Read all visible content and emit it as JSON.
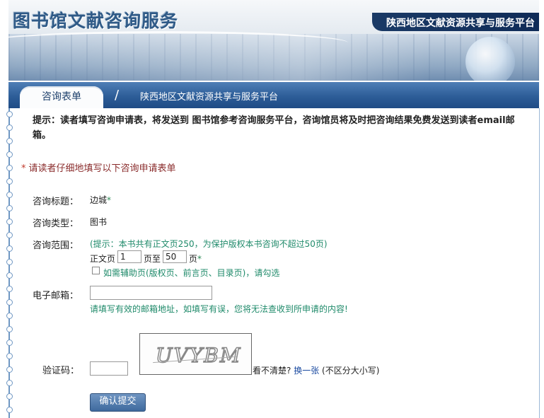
{
  "header": {
    "logo_text": "图书馆文献咨询服务",
    "platform_title": "陕西地区文献资源共享与服务平台"
  },
  "nav": {
    "active_tab": "咨询表单",
    "separator": "/",
    "breadcrumb": "陕西地区文献资源共享与服务平台"
  },
  "tip": "提示：读者填写咨询申请表，将发送到 图书馆参考咨询服务平台，咨询馆员将及时把咨询结果免费发送到读者email邮箱。",
  "notice": {
    "star": "*",
    "text": "请读者仔细地填写以下咨询申请表单"
  },
  "form": {
    "title_label": "咨询标题：",
    "title_value": "边城",
    "required_mark": "*",
    "type_label": "咨询类型：",
    "type_value": "图书",
    "range_label": "咨询范围：",
    "range_hint": "(提示：本书共有正文页250，为保护版权本书咨询不超过50页)",
    "page_prefix": "正文页",
    "page_from": "1",
    "page_mid": "页至",
    "page_to": "50",
    "page_suffix": "页",
    "aux_pages_label": "如需辅助页(版权页、前言页、目录页)，请勾选",
    "email_label": "电子邮箱：",
    "email_value": "",
    "email_hint": "请填写有效的邮箱地址，如填写有误，您将无法查收到所申请的内容!",
    "captcha_label": "验证码：",
    "captcha_value": "",
    "captcha_image_text": "UVYBM",
    "captcha_unclear": "看不清楚?",
    "captcha_refresh": "换一张",
    "captcha_case_note": "(不区分大小写)",
    "submit_label": "确认提交"
  },
  "colors": {
    "nav_blue": "#2d5d98",
    "hint_green": "#1f8a6a",
    "notice_red": "#8a2c2c",
    "link_blue": "#1a4aa0"
  }
}
